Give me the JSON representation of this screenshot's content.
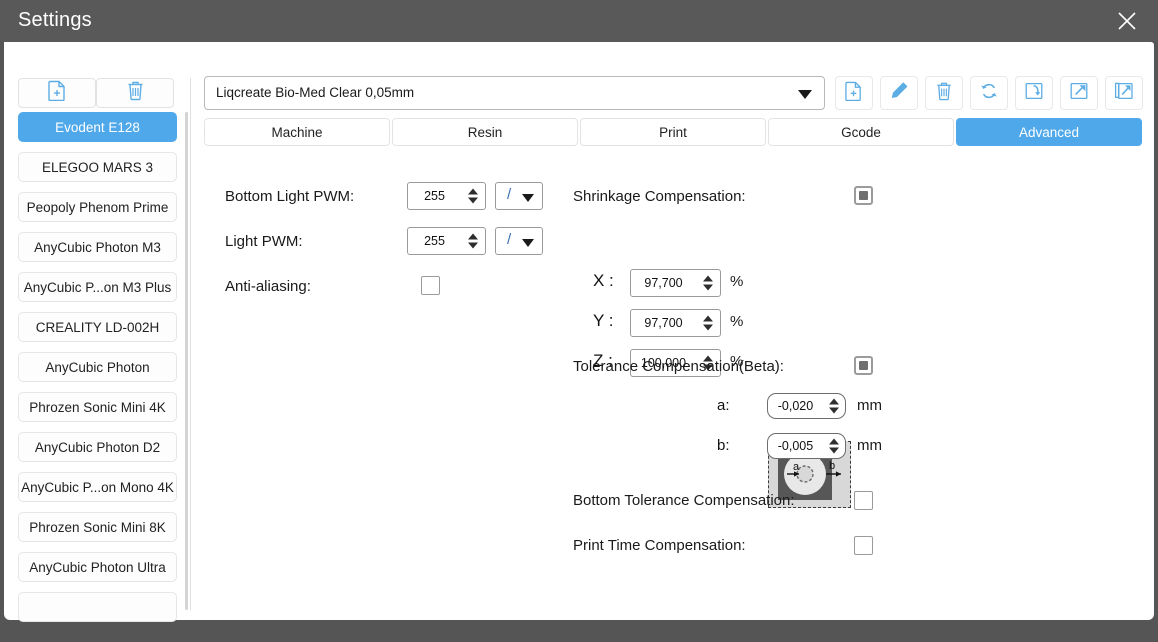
{
  "window": {
    "title": "Settings",
    "close_icon": "close-icon",
    "titlebar_color": "#595959",
    "accent_color": "#4fa8ea"
  },
  "left_panel": {
    "toolbar": [
      {
        "name": "new-profile-button",
        "icon": "file-plus-icon"
      },
      {
        "name": "delete-profile-button",
        "icon": "trash-icon"
      }
    ],
    "printers": [
      {
        "label": "Evodent E128",
        "selected": true
      },
      {
        "label": "ELEGOO MARS 3",
        "selected": false
      },
      {
        "label": "Peopoly Phenom Prime",
        "selected": false
      },
      {
        "label": "AnyCubic Photon M3",
        "selected": false
      },
      {
        "label": "AnyCubic P...on M3 Plus",
        "selected": false
      },
      {
        "label": "CREALITY LD-002H",
        "selected": false
      },
      {
        "label": "AnyCubic Photon",
        "selected": false
      },
      {
        "label": "Phrozen Sonic Mini 4K",
        "selected": false
      },
      {
        "label": "AnyCubic Photon D2",
        "selected": false
      },
      {
        "label": "AnyCubic P...on Mono 4K",
        "selected": false
      },
      {
        "label": "Phrozen Sonic Mini 8K",
        "selected": false
      },
      {
        "label": "AnyCubic Photon Ultra",
        "selected": false
      },
      {
        "label": "",
        "selected": false
      }
    ]
  },
  "right_panel": {
    "profile_select": {
      "value": "Liqcreate Bio-Med Clear 0,05mm",
      "arrow_icon": "chevron-down-icon"
    },
    "toolbar": [
      {
        "name": "new-resin-button",
        "icon": "file-plus-icon"
      },
      {
        "name": "edit-resin-button",
        "icon": "pencil-icon"
      },
      {
        "name": "delete-resin-button",
        "icon": "trash-icon"
      },
      {
        "name": "refresh-resin-button",
        "icon": "refresh-icon"
      },
      {
        "name": "import-resin-button",
        "icon": "import-arrow-icon"
      },
      {
        "name": "export-resin-button",
        "icon": "export-arrow-icon"
      },
      {
        "name": "export-all-button",
        "icon": "export-multiple-icon"
      }
    ],
    "tabs": [
      {
        "label": "Machine",
        "active": false
      },
      {
        "label": "Resin",
        "active": false
      },
      {
        "label": "Print",
        "active": false
      },
      {
        "label": "Gcode",
        "active": false
      },
      {
        "label": "Advanced",
        "active": true
      }
    ],
    "advanced": {
      "bottom_light_pwm": {
        "label": "Bottom Light PWM:",
        "value": "255",
        "unit_select": "/"
      },
      "light_pwm": {
        "label": "Light PWM:",
        "value": "255",
        "unit_select": "/"
      },
      "anti_aliasing": {
        "label": "Anti-aliasing:",
        "checked": false
      },
      "shrinkage_compensation": {
        "label": "Shrinkage Compensation:",
        "state": "filled",
        "axes": [
          {
            "axis": "X :",
            "value": "97,700",
            "unit": "%"
          },
          {
            "axis": "Y :",
            "value": "97,700",
            "unit": "%"
          },
          {
            "axis": "Z :",
            "value": "100,000",
            "unit": "%"
          }
        ]
      },
      "tolerance_compensation": {
        "label": "Tolerance Compensation(Beta):",
        "state": "filled",
        "diagram_icon": "tolerance-diagram-icon",
        "diagram_labels": {
          "a": "a",
          "b": "b"
        },
        "fields": [
          {
            "label": "a:",
            "value": "-0,020",
            "unit": "mm"
          },
          {
            "label": "b:",
            "value": "-0,005",
            "unit": "mm"
          }
        ]
      },
      "bottom_tolerance_compensation": {
        "label": "Bottom Tolerance Compensation:",
        "checked": false
      },
      "print_time_compensation": {
        "label": "Print Time Compensation:",
        "checked": false
      }
    }
  }
}
